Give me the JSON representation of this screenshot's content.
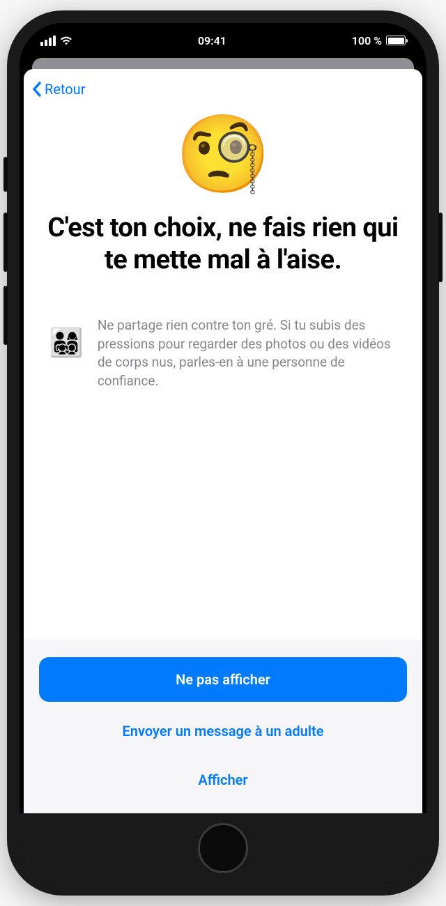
{
  "status": {
    "time": "09:41",
    "battery_text": "100 %"
  },
  "nav": {
    "back_label": "Retour"
  },
  "hero": {
    "emoji": "🧐",
    "title": "C'est ton choix, ne fais rien qui te mette mal à l'aise."
  },
  "info": {
    "emoji": "👨‍👩‍👧‍👦",
    "text": "Ne partage rien contre ton gré. Si tu subis des pressions pour regarder des photos ou des vidéos de corps nus, parles-en à une personne de confiance."
  },
  "buttons": {
    "primary": "Ne pas afficher",
    "message_adult": "Envoyer un message à un adulte",
    "show": "Afficher"
  }
}
